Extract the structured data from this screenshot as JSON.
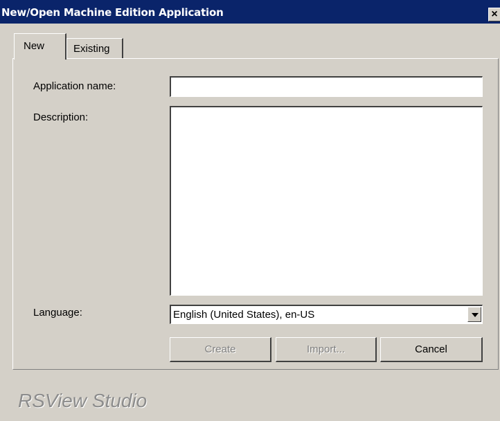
{
  "window": {
    "title": "New/Open Machine Edition Application",
    "close_symbol": "×"
  },
  "tabs": [
    {
      "label": "New",
      "selected": true
    },
    {
      "label": "Existing",
      "selected": false
    }
  ],
  "form": {
    "application_name_label": "Application name:",
    "application_name_value": "",
    "description_label": "Description:",
    "description_value": "",
    "language_label": "Language:",
    "language_value": "English (United States), en-US"
  },
  "buttons": {
    "create_label": "Create",
    "import_label": "Import...",
    "cancel_label": "Cancel"
  },
  "branding": {
    "product": "RSView Studio"
  },
  "colors": {
    "titlebar": "#0a246a",
    "face": "#d4d0c8",
    "disabled_text": "#808080"
  },
  "icons": {
    "close": "close-icon",
    "dropdown": "chevron-down-icon"
  }
}
